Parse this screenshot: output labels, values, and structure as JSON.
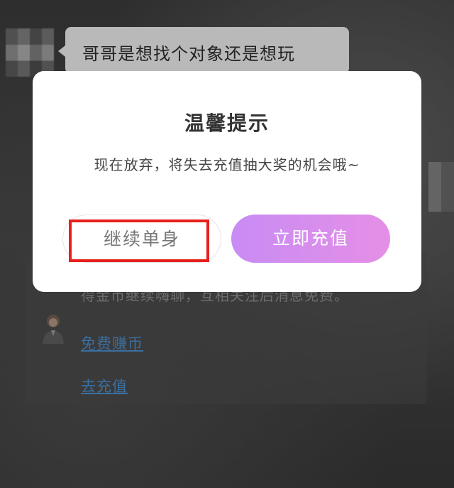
{
  "background": {
    "chat_message": "哥哥是想找个对象还是想玩",
    "card_text": "得金币继续嗨聊，互相关注后消息免费。",
    "links": {
      "earn_coins": "免费赚币",
      "recharge": "去充值"
    }
  },
  "dialog": {
    "title": "温馨提示",
    "message": "现在放弃，将失去充值抽大奖的机会哦~",
    "buttons": {
      "stay_single": "继续单身",
      "recharge_now": "立即充值"
    }
  },
  "colors": {
    "primary_gradient_start": "#c88cf4",
    "primary_gradient_end": "#e58fe6",
    "highlight_red": "#e8201c",
    "link_blue": "#3a6fa0"
  },
  "icons": {
    "sender_avatar": "blurred-avatar-icon",
    "agent_avatar": "agent-avatar-icon"
  }
}
